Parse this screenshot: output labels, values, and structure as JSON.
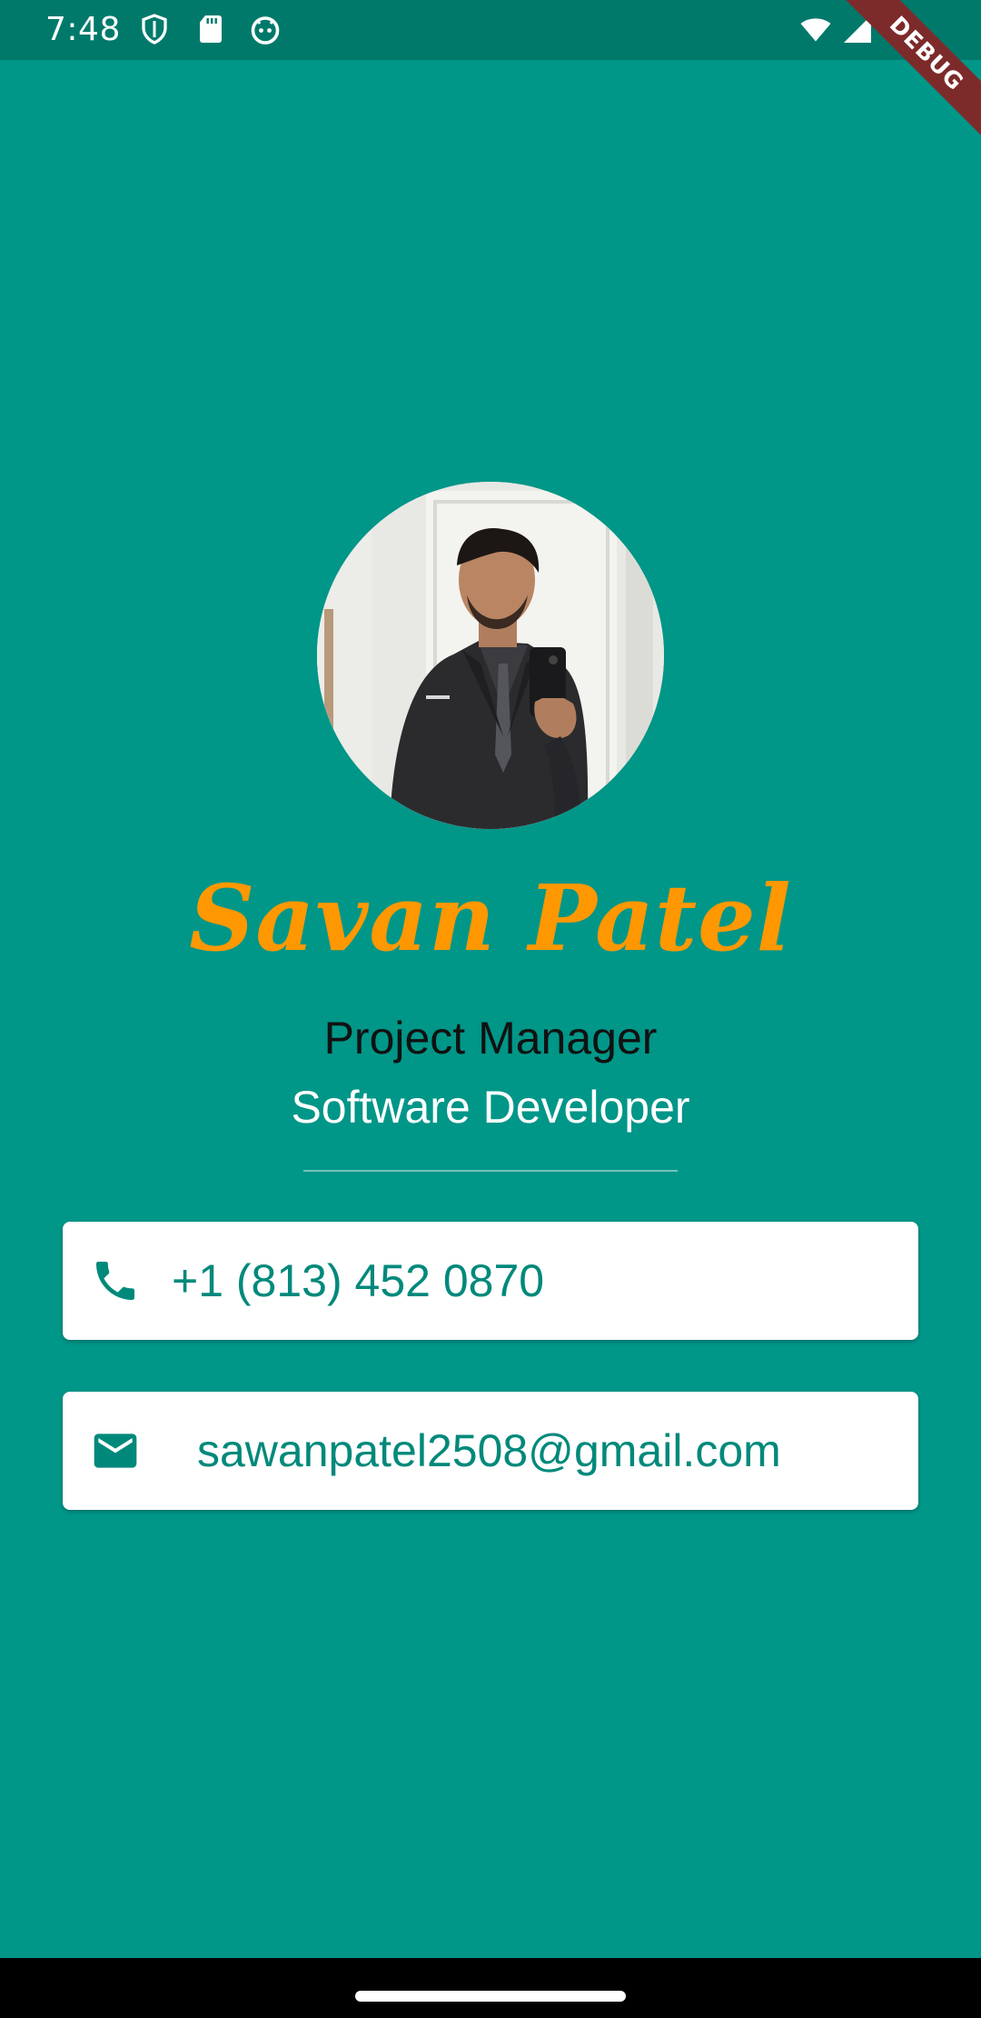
{
  "status_bar": {
    "time": "7:48",
    "left_icons": [
      "shield-icon",
      "sd-card-icon",
      "android-icon"
    ],
    "right_icons": [
      "wifi-icon",
      "cell-signal-icon",
      "battery-icon"
    ]
  },
  "debug_banner": "DEBUG",
  "profile": {
    "name": "Savan Patel",
    "title": "Project Manager",
    "role": "Software Developer"
  },
  "contacts": {
    "phone": {
      "icon": "phone-icon",
      "value": "+1 (813) 452 0870"
    },
    "email": {
      "icon": "mail-icon",
      "value": "sawanpatel2508@gmail.com"
    }
  },
  "colors": {
    "background": "#009688",
    "status_bar": "#00796b",
    "name_accent": "#ff9800",
    "card_text": "#00897b",
    "card_background": "#ffffff"
  }
}
